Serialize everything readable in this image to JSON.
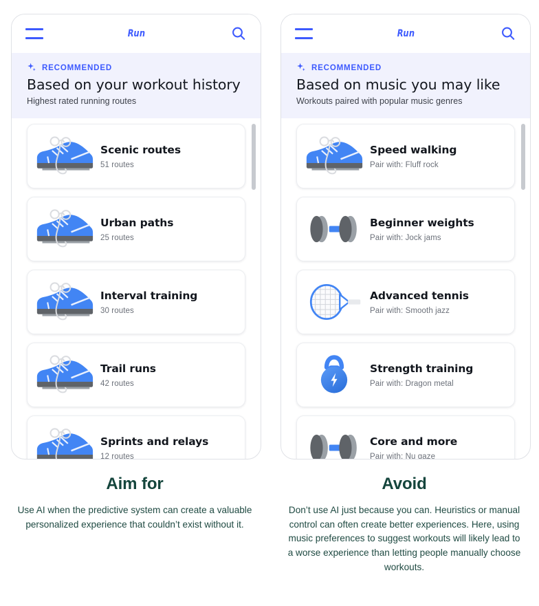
{
  "panels": [
    {
      "id": "aim-for",
      "appbar": {
        "menu_icon": "hamburger-icon",
        "brand": "Run",
        "search_icon": "search-icon"
      },
      "recommended": {
        "icon": "sparkle-icon",
        "label": "RECOMMENDED",
        "title": "Based on your workout history",
        "subtitle": "Highest rated running routes"
      },
      "items": [
        {
          "icon": "running-shoe-icon",
          "title": "Scenic routes",
          "meta": "51 routes"
        },
        {
          "icon": "running-shoe-icon",
          "title": "Urban paths",
          "meta": "25 routes"
        },
        {
          "icon": "running-shoe-icon",
          "title": "Interval training",
          "meta": "30 routes"
        },
        {
          "icon": "running-shoe-icon",
          "title": "Trail runs",
          "meta": "42 routes"
        },
        {
          "icon": "running-shoe-icon",
          "title": "Sprints and relays",
          "meta": "12 routes"
        }
      ],
      "caption": {
        "heading": "Aim for",
        "body": "Use AI when the predictive system can create a valuable personalized experience that couldn’t exist without it."
      }
    },
    {
      "id": "avoid",
      "appbar": {
        "menu_icon": "hamburger-icon",
        "brand": "Run",
        "search_icon": "search-icon"
      },
      "recommended": {
        "icon": "sparkle-icon",
        "label": "RECOMMENDED",
        "title": "Based on music you may like",
        "subtitle": "Workouts paired with popular music genres"
      },
      "items": [
        {
          "icon": "running-shoe-icon",
          "title": "Speed walking",
          "meta": "Pair with: Fluff rock"
        },
        {
          "icon": "dumbbell-icon",
          "title": "Beginner weights",
          "meta": "Pair with: Jock jams"
        },
        {
          "icon": "tennis-racket-icon",
          "title": "Advanced tennis",
          "meta": "Pair with: Smooth jazz"
        },
        {
          "icon": "kettlebell-icon",
          "title": "Strength training",
          "meta": "Pair with: Dragon metal"
        },
        {
          "icon": "dumbbell-icon",
          "title": "Core and more",
          "meta": "Pair with: Nu gaze"
        }
      ],
      "caption": {
        "heading": "Avoid",
        "body": "Don’t use AI just because you can. Heuristics or manual control can often create better experiences. Here, using music preferences to suggest workouts will likely lead to a worse experience than letting people manually choose workouts."
      }
    }
  ],
  "colors": {
    "accent_blue": "#3d5afe",
    "band_lavender": "#f1f2fd",
    "caption_green": "#14453c",
    "icon_blue": "#4285f4",
    "icon_gray": "#5f6368",
    "card_border": "#eceef1",
    "scrollbar": "#c7cacf"
  }
}
